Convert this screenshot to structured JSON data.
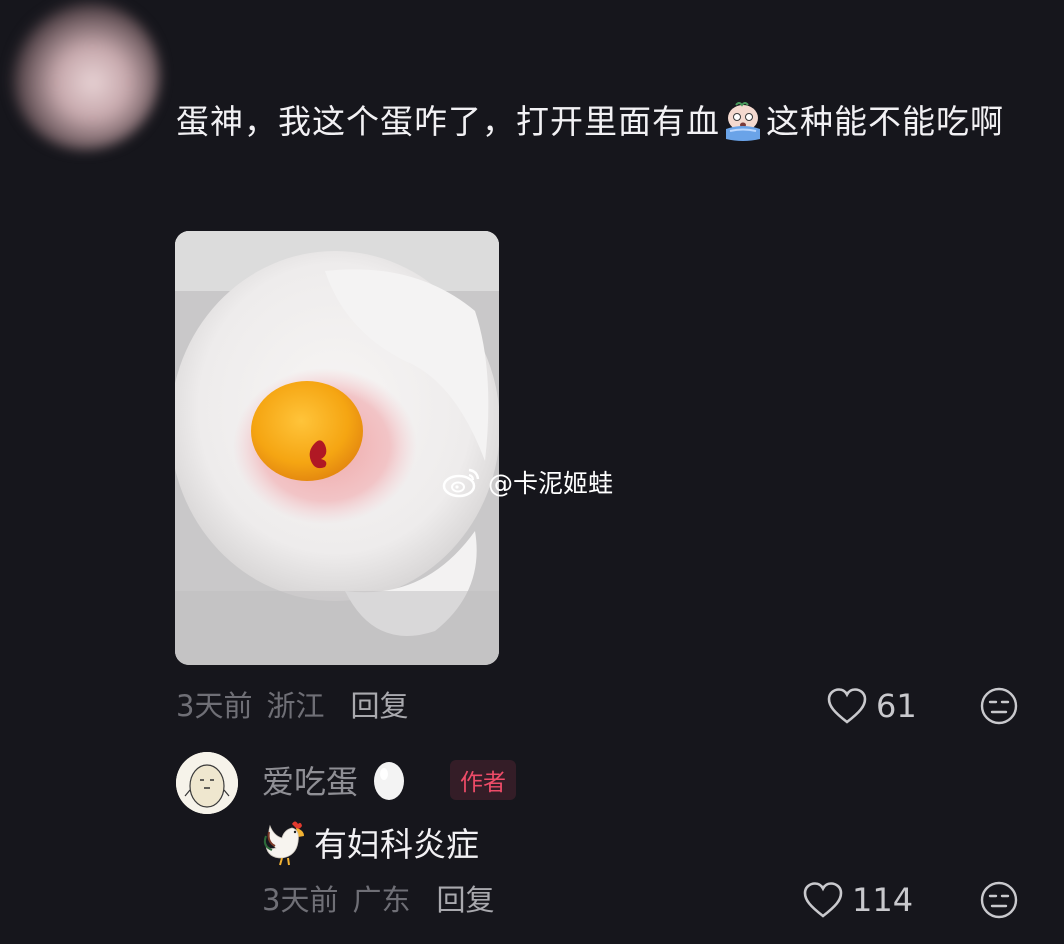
{
  "comment": {
    "text_part1": "蛋神，我这个蛋咋了，打开里面有血",
    "text_part2": "这种能不能吃啊",
    "inline_emoji_icon": "crying-face-icon",
    "time": "3天前",
    "location": "浙江",
    "reply_label": "回复",
    "likes": "61"
  },
  "watermark": {
    "text": "@卡泥姬蛙",
    "icon": "weibo-logo-icon"
  },
  "reply": {
    "username": "爱吃蛋",
    "name_emoji_icon": "egg-icon",
    "badge": "作者",
    "text": "有妇科炎症",
    "text_emoji_icon": "rooster-icon",
    "time": "3天前",
    "location": "广东",
    "reply_label": "回复",
    "likes": "114"
  },
  "colors": {
    "background": "#16161c",
    "text_primary": "#f2f1f4",
    "text_secondary": "#6f6f76",
    "author_badge": "#ee4c68"
  }
}
